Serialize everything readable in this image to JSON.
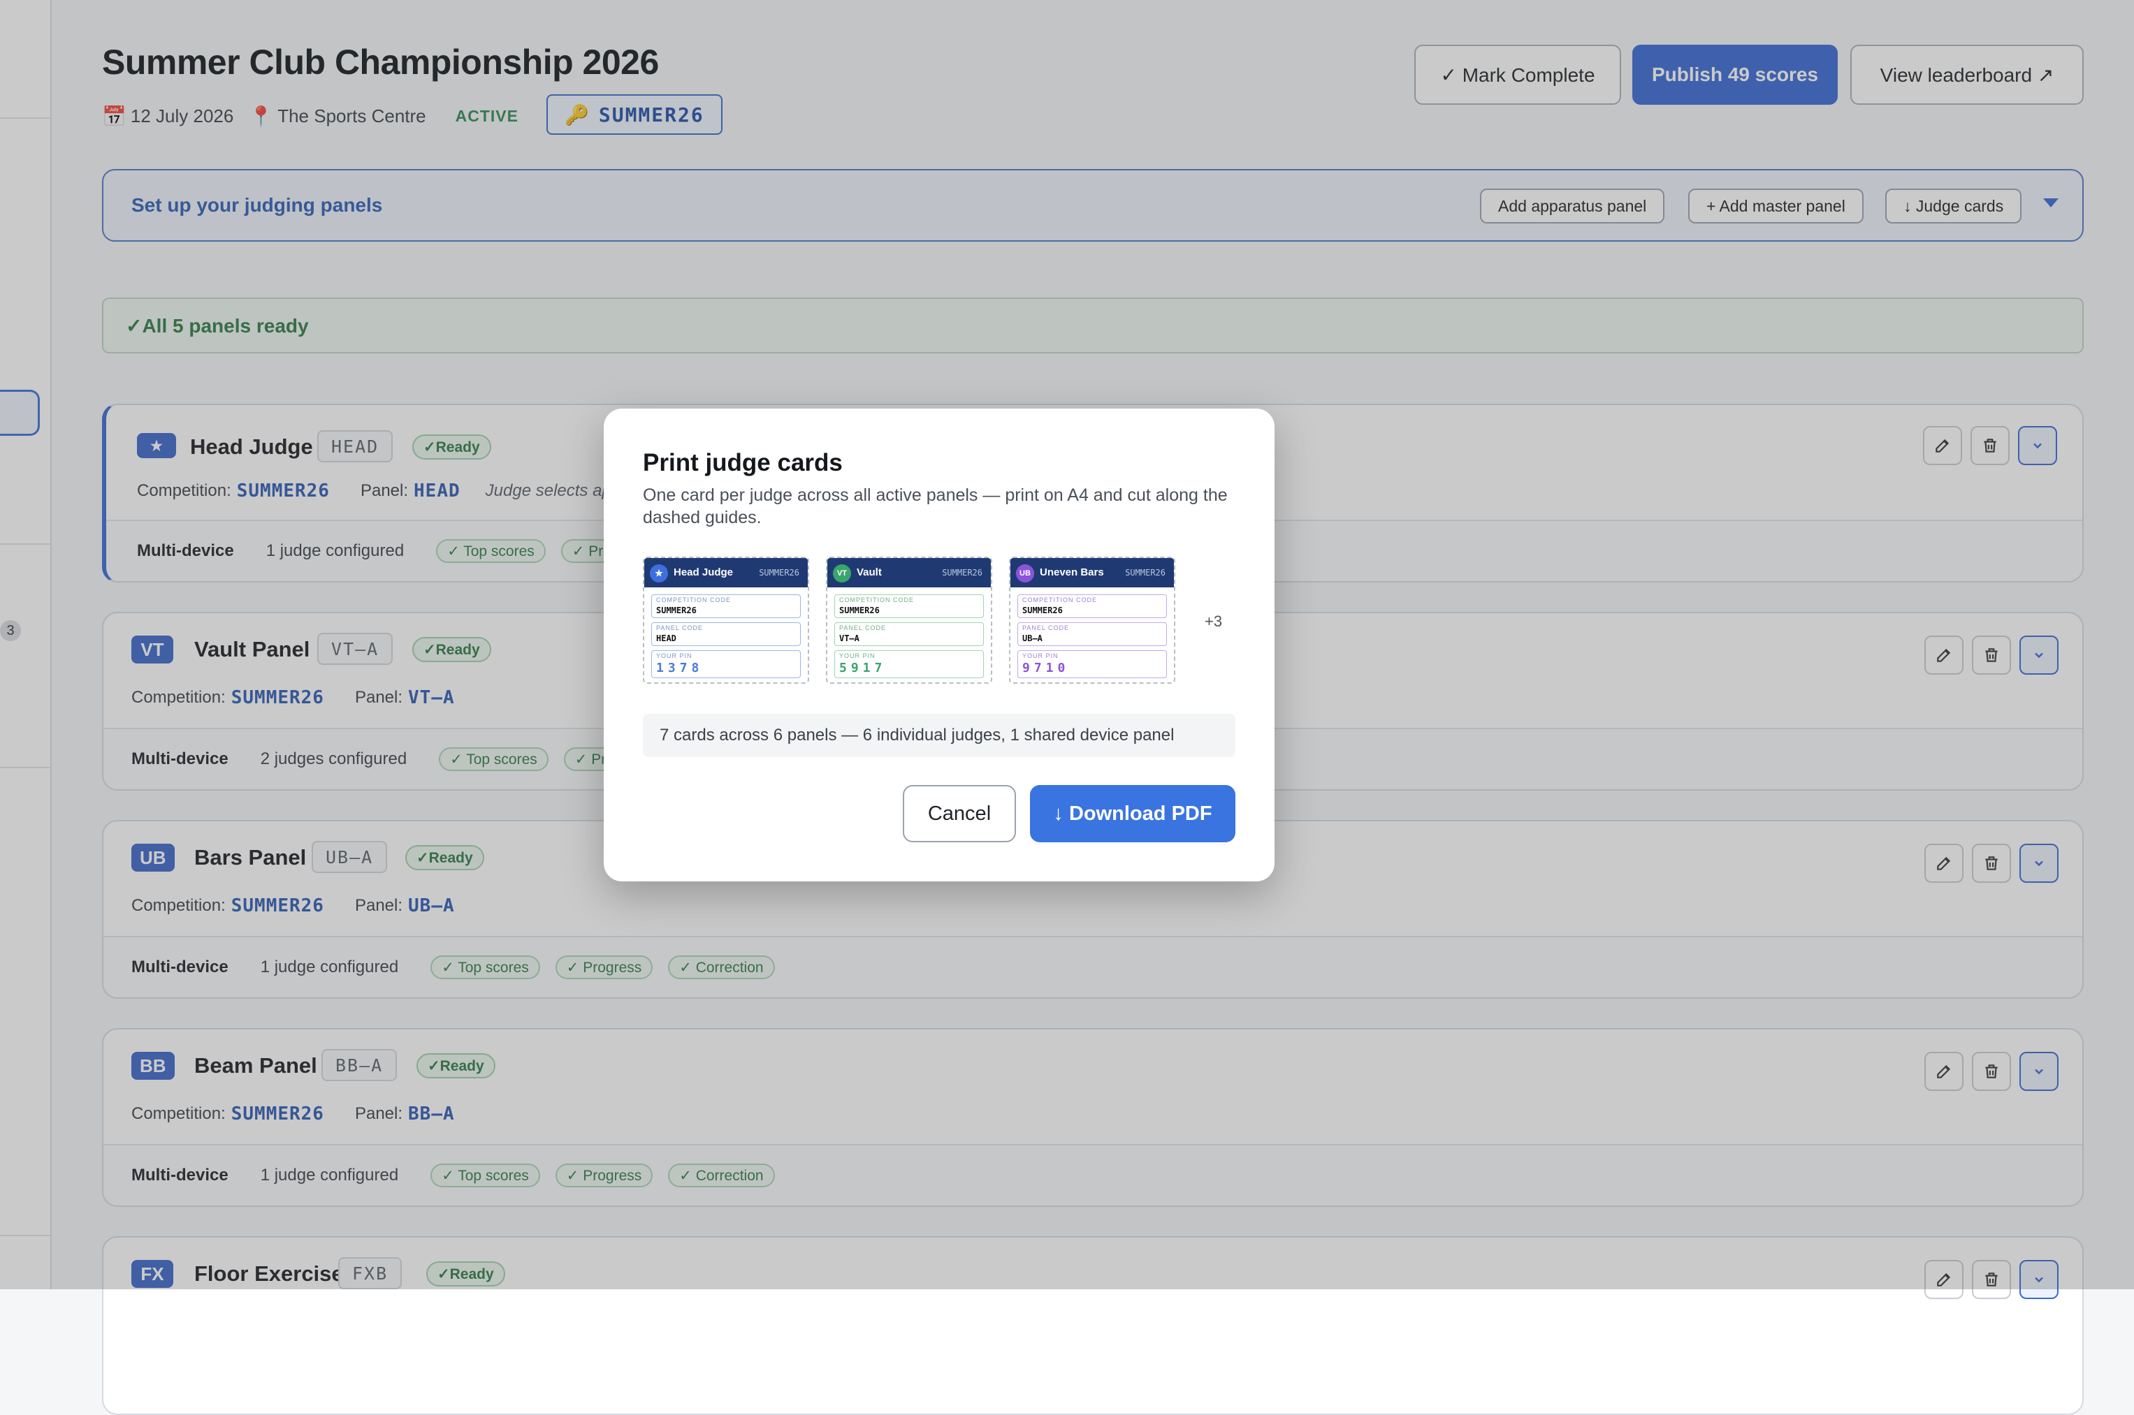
{
  "header": {
    "title": "Summer Club Championship 2026",
    "date": "12 July 2026",
    "venue": "The Sports Centre",
    "status": "ACTIVE",
    "code": "SUMMER26",
    "mark_complete": "✓ Mark Complete",
    "publish": "Publish 49 scores",
    "view_leaderboard": "View leaderboard ↗"
  },
  "sidebar": {
    "badge_count": "3"
  },
  "setup": {
    "title": "Set up your judging panels",
    "add_apparatus": "Add apparatus panel",
    "add_master": "+ Add master panel",
    "judge_cards": "↓ Judge cards"
  },
  "ready_banner": "✓All 5 panels ready",
  "labels": {
    "competition": "Competition:",
    "panel": "Panel:",
    "multi_device": "Multi-device",
    "ready": "✓Ready"
  },
  "panels": [
    {
      "badge": "★",
      "name": "Head Judge",
      "code": "HEAD",
      "comp_code": "SUMMER26",
      "panel_code": "HEAD",
      "note": "Judge selects app",
      "judges": "1 judge configured",
      "chips": [
        "✓ Top scores",
        "✓ Progress"
      ]
    },
    {
      "badge": "VT",
      "name": "Vault Panel",
      "code": "VT–A",
      "comp_code": "SUMMER26",
      "panel_code": "VT–A",
      "judges": "2 judges configured",
      "chips": [
        "✓ Top scores",
        "✓ Pro"
      ]
    },
    {
      "badge": "UB",
      "name": "Bars Panel",
      "code": "UB–A",
      "comp_code": "SUMMER26",
      "panel_code": "UB–A",
      "judges": "1 judge configured",
      "chips": [
        "✓ Top scores",
        "✓ Progress",
        "✓ Correction"
      ]
    },
    {
      "badge": "BB",
      "name": "Beam Panel",
      "code": "BB–A",
      "comp_code": "SUMMER26",
      "panel_code": "BB–A",
      "judges": "1 judge configured",
      "chips": [
        "✓ Top scores",
        "✓ Progress",
        "✓ Correction"
      ]
    },
    {
      "badge": "FX",
      "name": "Floor Exercise",
      "code": "FXB"
    }
  ],
  "modal": {
    "title": "Print judge cards",
    "description": "One card per judge across all active panels — print on A4 and cut along the dashed guides.",
    "cards": [
      {
        "dot": "★",
        "dot_color": "#3d6fe0",
        "title": "Head Judge",
        "code": "SUMMER26",
        "comp_label": "COMPETITION CODE",
        "comp_value": "SUMMER26",
        "panel_label": "PANEL CODE",
        "panel_value": "HEAD",
        "pin_label": "YOUR PIN",
        "pin": "1378",
        "accent": "#4a7ad8"
      },
      {
        "dot": "VT",
        "dot_color": "#3aa56b",
        "title": "Vault",
        "code": "SUMMER26",
        "comp_label": "COMPETITION CODE",
        "comp_value": "SUMMER26",
        "panel_label": "PANEL CODE",
        "panel_value": "VT–A",
        "pin_label": "YOUR PIN",
        "pin": "5917",
        "accent": "#3aa56b"
      },
      {
        "dot": "UB",
        "dot_color": "#8a55d8",
        "title": "Uneven Bars",
        "code": "SUMMER26",
        "comp_label": "COMPETITION CODE",
        "comp_value": "SUMMER26",
        "panel_label": "PANEL CODE",
        "panel_value": "UB–A",
        "pin_label": "YOUR PIN",
        "pin": "9710",
        "accent": "#8a55d8"
      }
    ],
    "more": "+3",
    "summary": "7 cards across 6 panels — 6 individual judges, 1 shared device panel",
    "cancel": "Cancel",
    "download": "↓ Download PDF"
  }
}
